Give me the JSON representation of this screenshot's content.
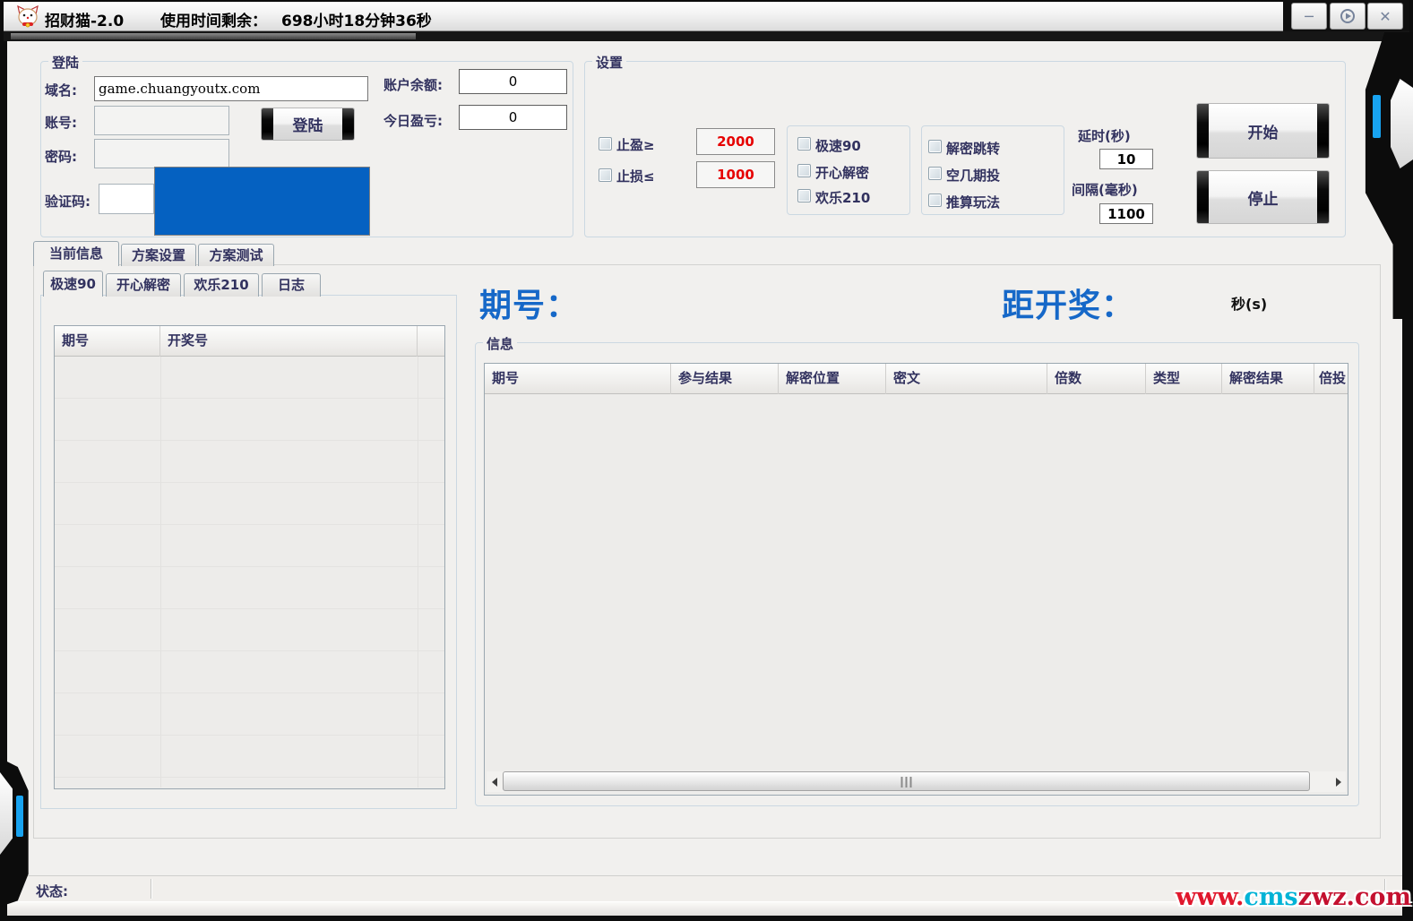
{
  "titlebar": {
    "app_title": "招财猫-2.0",
    "time_label": "使用时间剩余：",
    "time_value": "698小时18分钟36秒",
    "minimize_glyph": "─",
    "close_glyph": "✕"
  },
  "login": {
    "group_label": "登陆",
    "domain_label": "域名:",
    "domain_value": "game.chuangyoutx.com",
    "account_label": "账号:",
    "password_label": "密码:",
    "captcha_label": "验证码:",
    "login_button": "登陆",
    "balance_label": "账户余额:",
    "balance_value": "0",
    "profit_label": "今日盈亏:",
    "profit_value": "0"
  },
  "settings": {
    "group_label": "设置",
    "stop_win_label": "止盈≥",
    "stop_win_value": "2000",
    "stop_loss_label": "止损≤",
    "stop_loss_value": "1000",
    "game_options": [
      "极速90",
      "开心解密",
      "欢乐210"
    ],
    "mode_options": [
      "解密跳转",
      "空几期投",
      "推算玩法"
    ],
    "delay_label": "延时(秒)",
    "delay_value": "10",
    "interval_label": "间隔(毫秒)",
    "interval_value": "1100",
    "start_button": "开始",
    "stop_button": "停止"
  },
  "tabs": {
    "main": [
      "当前信息",
      "方案设置",
      "方案测试"
    ],
    "sub": [
      "极速90",
      "开心解密",
      "欢乐210",
      "日志"
    ]
  },
  "left_table": {
    "headers": [
      "期号",
      "开奖号"
    ]
  },
  "live": {
    "period_label": "期号：",
    "countdown_label": "距开奖：",
    "seconds_unit": "秒(s)"
  },
  "info": {
    "group_label": "信息",
    "headers": [
      "期号",
      "参与结果",
      "解密位置",
      "密文",
      "倍数",
      "类型",
      "解密结果",
      "倍投"
    ]
  },
  "statusbar": {
    "label": "状态:"
  },
  "watermark": {
    "part1": "www.",
    "part2": "cms",
    "part3": "zwz.com"
  },
  "colors": {
    "accent_blue": "#18a3f0",
    "captcha_blue": "#0561c1",
    "value_red": "#e60000",
    "headline_blue": "#1668c8",
    "label_navy": "#32325f"
  }
}
